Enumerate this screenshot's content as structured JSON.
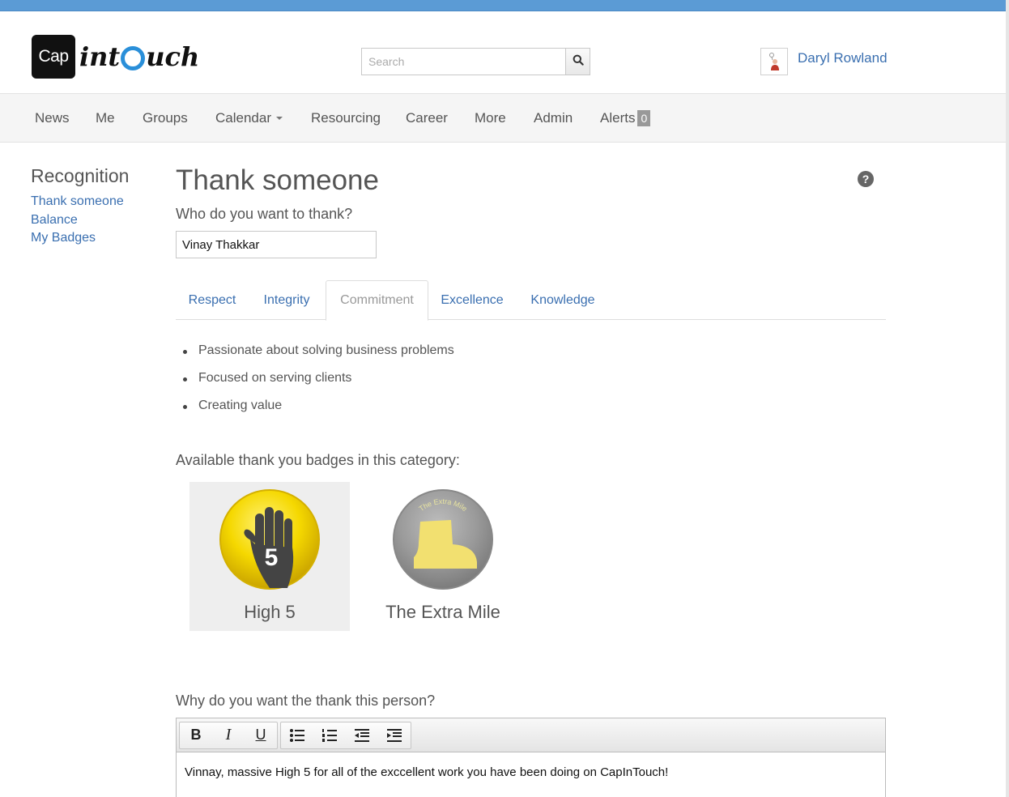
{
  "header": {
    "logo": {
      "box_text": "Cap",
      "word_before": "int",
      "word_after": "uch"
    },
    "search": {
      "placeholder": "Search"
    },
    "user": {
      "name": "Daryl Rowland"
    }
  },
  "nav": {
    "items": [
      {
        "label": "News"
      },
      {
        "label": "Me"
      },
      {
        "label": "Groups"
      },
      {
        "label": "Calendar"
      },
      {
        "label": "Resourcing"
      },
      {
        "label": "Career"
      },
      {
        "label": "More"
      },
      {
        "label": "Admin"
      },
      {
        "label": "Alerts"
      }
    ],
    "alerts_count": "0"
  },
  "sidebar": {
    "title": "Recognition",
    "links": [
      {
        "label": "Thank someone"
      },
      {
        "label": "Balance"
      },
      {
        "label": "My Badges"
      }
    ]
  },
  "main": {
    "title": "Thank someone",
    "help_icon": "?",
    "recipient_label": "Who do you want to thank?",
    "recipient_value": "Vinay Thakkar",
    "tabs": [
      {
        "label": "Respect"
      },
      {
        "label": "Integrity"
      },
      {
        "label": "Commitment"
      },
      {
        "label": "Excellence"
      },
      {
        "label": "Knowledge"
      }
    ],
    "active_tab": "Commitment",
    "bullets": [
      "Passionate about solving business problems",
      "Focused on serving clients",
      "Creating value"
    ],
    "badges_label": "Available thank you badges in this category:",
    "badges": [
      {
        "name": "High 5",
        "number": "5",
        "icon": "hand-icon",
        "color": "#f5d800",
        "selected": true
      },
      {
        "name": "The Extra Mile",
        "arc_text": "The Extra Mile",
        "icon": "boot-icon",
        "color": "#9a9a9a",
        "selected": false
      }
    ],
    "reason_label": "Why do you want the thank this person?",
    "editor": {
      "toolbar": [
        "B",
        "I",
        "U"
      ],
      "toolbar_icons": [
        "bullet-list-icon",
        "numbered-list-icon",
        "outdent-icon",
        "indent-icon"
      ],
      "text": "Vinnay, massive High 5 for all of the exccellent work you have been doing on CapInTouch!"
    }
  },
  "colors": {
    "link": "#3a6fb0",
    "top_bar": "#5b9bd5",
    "logo_accent": "#2a8fd9"
  }
}
